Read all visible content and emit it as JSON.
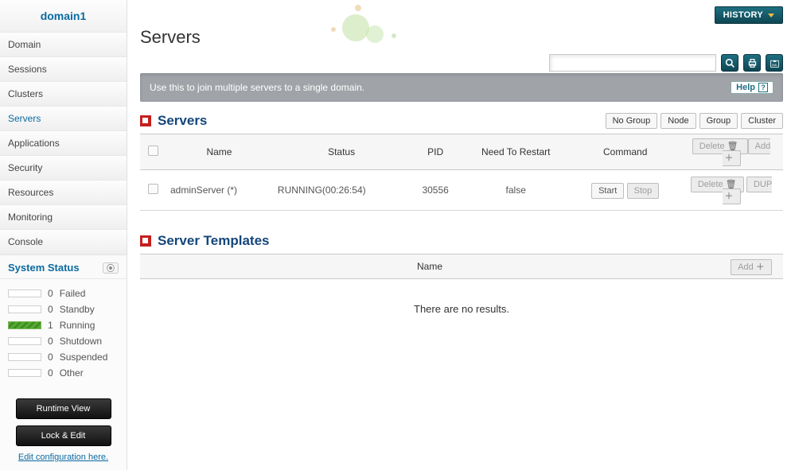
{
  "domain_title": "domain1",
  "nav": {
    "items": [
      {
        "label": "Domain"
      },
      {
        "label": "Sessions"
      },
      {
        "label": "Clusters"
      },
      {
        "label": "Servers"
      },
      {
        "label": "Applications"
      },
      {
        "label": "Security"
      },
      {
        "label": "Resources"
      },
      {
        "label": "Monitoring"
      },
      {
        "label": "Console"
      }
    ],
    "active_index": 3
  },
  "system_status": {
    "title": "System Status",
    "rows": [
      {
        "count": "0",
        "label": "Failed",
        "running": false
      },
      {
        "count": "0",
        "label": "Standby",
        "running": false
      },
      {
        "count": "1",
        "label": "Running",
        "running": true
      },
      {
        "count": "0",
        "label": "Shutdown",
        "running": false
      },
      {
        "count": "0",
        "label": "Suspended",
        "running": false
      },
      {
        "count": "0",
        "label": "Other",
        "running": false
      }
    ]
  },
  "side_actions": {
    "runtime_view": "Runtime View",
    "lock_edit": "Lock & Edit",
    "edit_link": "Edit configuration here."
  },
  "topbar": {
    "history": "HISTORY",
    "search_placeholder": ""
  },
  "page": {
    "title": "Servers",
    "banner": "Use this to join multiple servers to a single domain.",
    "help": "Help"
  },
  "servers_section": {
    "title": "Servers",
    "scope_buttons": [
      "No Group",
      "Node",
      "Group",
      "Cluster"
    ],
    "header_buttons": {
      "delete": "Delete",
      "add": "Add"
    },
    "columns": {
      "name": "Name",
      "status": "Status",
      "pid": "PID",
      "restart": "Need To Restart",
      "command": "Command"
    },
    "rows": [
      {
        "name": "adminServer (*)",
        "status": "RUNNING(00:26:54)",
        "pid": "30556",
        "restart": "false",
        "start": "Start",
        "stop": "Stop",
        "delete": "Delete",
        "dup": "DUP"
      }
    ]
  },
  "templates_section": {
    "title": "Server Templates",
    "columns": {
      "name": "Name"
    },
    "add": "Add",
    "empty": "There are no results."
  }
}
